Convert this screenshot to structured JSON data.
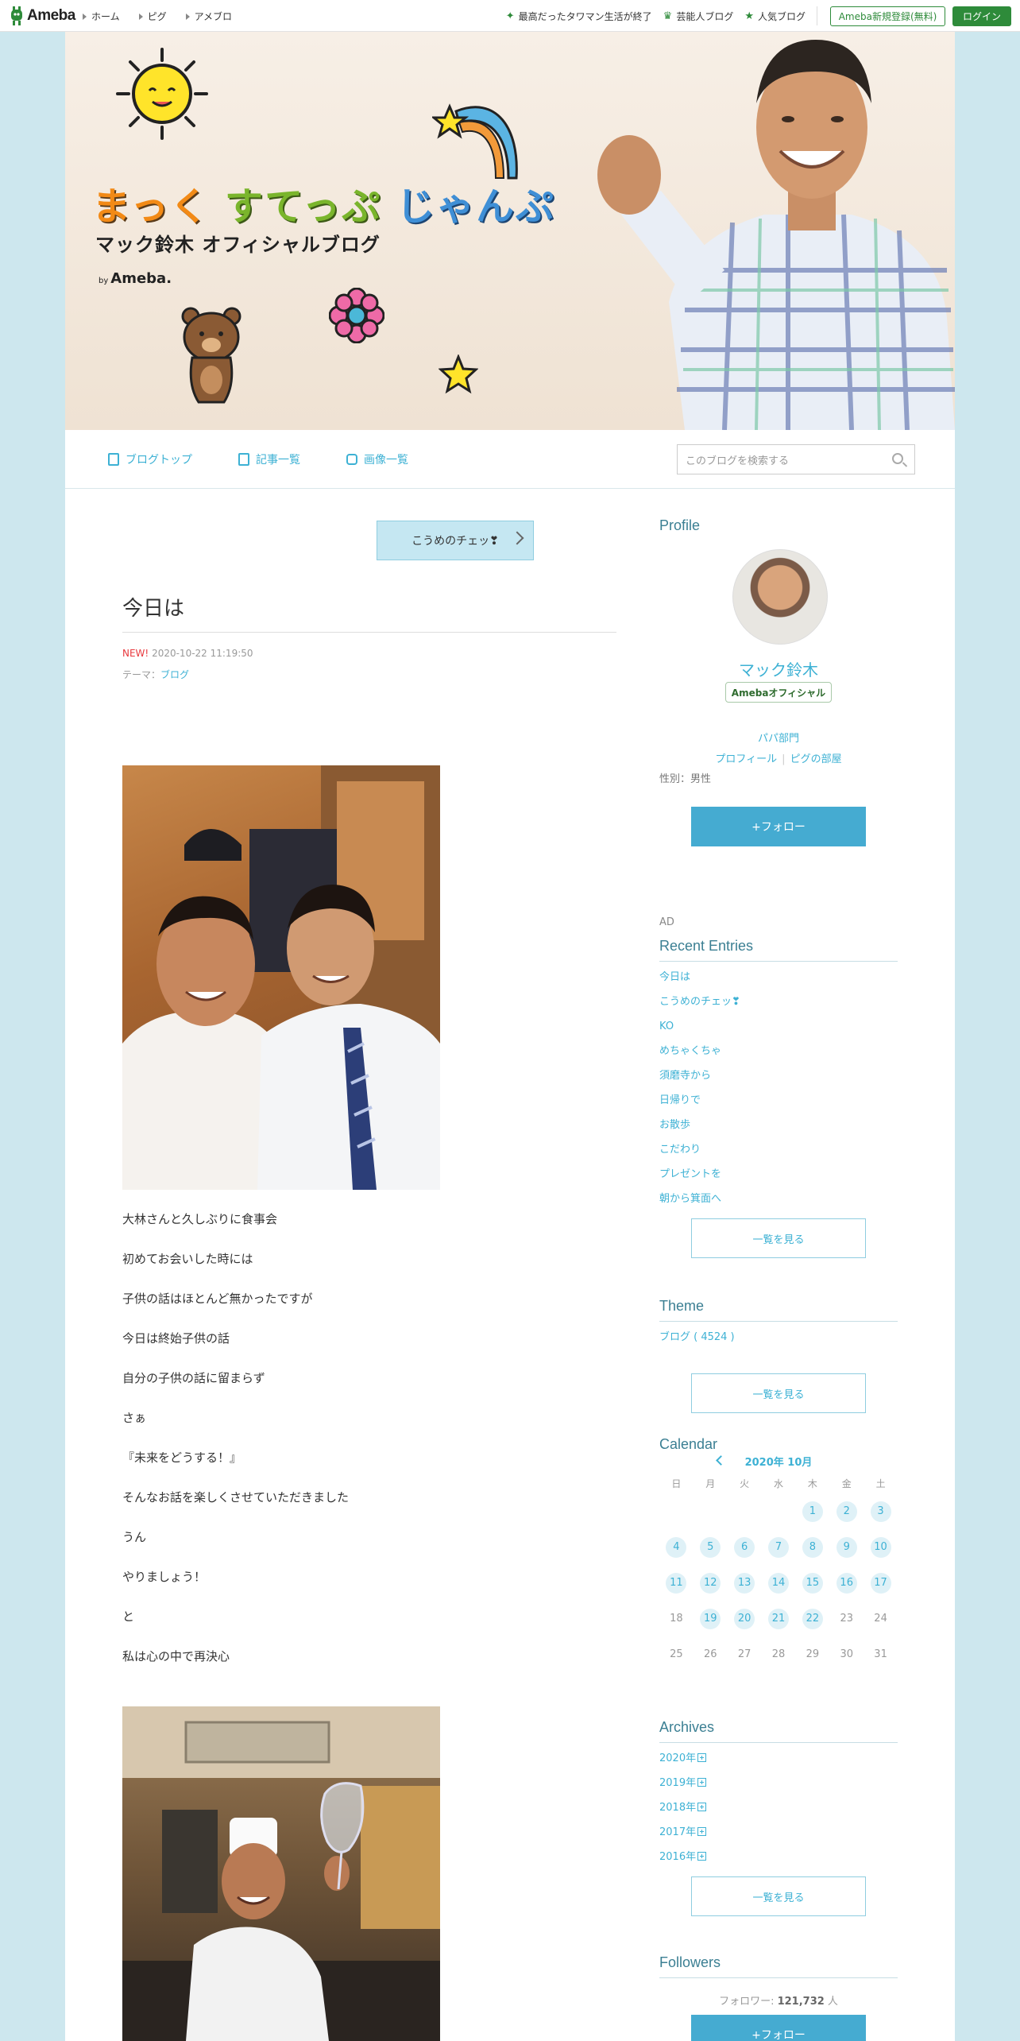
{
  "global_header": {
    "logo": "Ameba",
    "nav": [
      "ホーム",
      "ピグ",
      "アメブロ"
    ],
    "right_links": [
      "最高だったタワマン生活が終了",
      "芸能人ブログ",
      "人気ブログ"
    ],
    "register_label": "Ameba新規登録(無料)",
    "login_label": "ログイン"
  },
  "banner": {
    "title_parts": [
      "まっく",
      "すてっぷ",
      "じゃんぷ"
    ],
    "subtitle": "マック鈴木 オフィシャルブログ",
    "by": "by",
    "byline": "Ameba."
  },
  "blog_nav": {
    "items": [
      "ブログトップ",
      "記事一覧",
      "画像一覧"
    ],
    "search_placeholder": "このブログを検索する"
  },
  "entry": {
    "prev_label": "こうめのチェッ❣",
    "title": "今日は",
    "new_label": "NEW!",
    "datetime": "2020-10-22 11:19:50",
    "theme_prefix": "テーマ：",
    "theme": "ブログ",
    "paragraphs": [
      "大林さんと久しぶりに食事会",
      "初めてお会いした時には",
      "子供の話はほとんど無かったですが",
      "今日は終始子供の話",
      "自分の子供の話に留まらず",
      "さぁ",
      "『未来をどうする！』",
      "そんなお話を楽しくさせていただきました",
      "うん",
      "やりましょう！",
      "と",
      "私は心の中で再決心"
    ]
  },
  "sidebar": {
    "profile": {
      "heading": "Profile",
      "name": "マック鈴木",
      "badge": "Amebaオフィシャル",
      "category": "パパ部門",
      "link_profile": "プロフィール",
      "link_room": "ピグの部屋",
      "gender": "性別：男性",
      "follow_label": "+フォロー"
    },
    "ad_label": "AD",
    "recent": {
      "heading": "Recent Entries",
      "items": [
        "今日は",
        "こうめのチェッ❣",
        "KO",
        "めちゃくちゃ",
        "須磨寺から",
        "日帰りで",
        "お散歩",
        "こだわり",
        "プレゼントを",
        "朝から箕面へ"
      ],
      "more_label": "一覧を見る"
    },
    "theme": {
      "heading": "Theme",
      "item": "ブログ ( 4524 )",
      "more_label": "一覧を見る"
    },
    "calendar": {
      "heading": "Calendar",
      "month": "2020年 10月",
      "dow": [
        "日",
        "月",
        "火",
        "水",
        "木",
        "金",
        "土"
      ],
      "cells": [
        "",
        "",
        "",
        "",
        "1",
        "2",
        "3",
        "4",
        "5",
        "6",
        "7",
        "8",
        "9",
        "10",
        "11",
        "12",
        "13",
        "14",
        "15",
        "16",
        "17",
        "18",
        "19",
        "20",
        "21",
        "22",
        "23",
        "24",
        "25",
        "26",
        "27",
        "28",
        "29",
        "30",
        "31"
      ],
      "posted_days": [
        "1",
        "2",
        "3",
        "4",
        "5",
        "6",
        "7",
        "8",
        "9",
        "10",
        "11",
        "12",
        "13",
        "14",
        "15",
        "16",
        "17",
        "19",
        "20",
        "21",
        "22"
      ]
    },
    "archives": {
      "heading": "Archives",
      "items": [
        "2020年",
        "2019年",
        "2018年",
        "2017年",
        "2016年"
      ],
      "more_label": "一覧を見る"
    },
    "followers": {
      "heading": "Followers",
      "prefix": "フォロワー: ",
      "count": "121,732",
      "suffix": " 人",
      "follow_label": "+フォロー"
    }
  },
  "colors": {
    "page_bg": "#cde7ee",
    "accent": "#3db1d4",
    "ameba_green": "#2e8b3a",
    "follow_bg": "#45abd1"
  }
}
